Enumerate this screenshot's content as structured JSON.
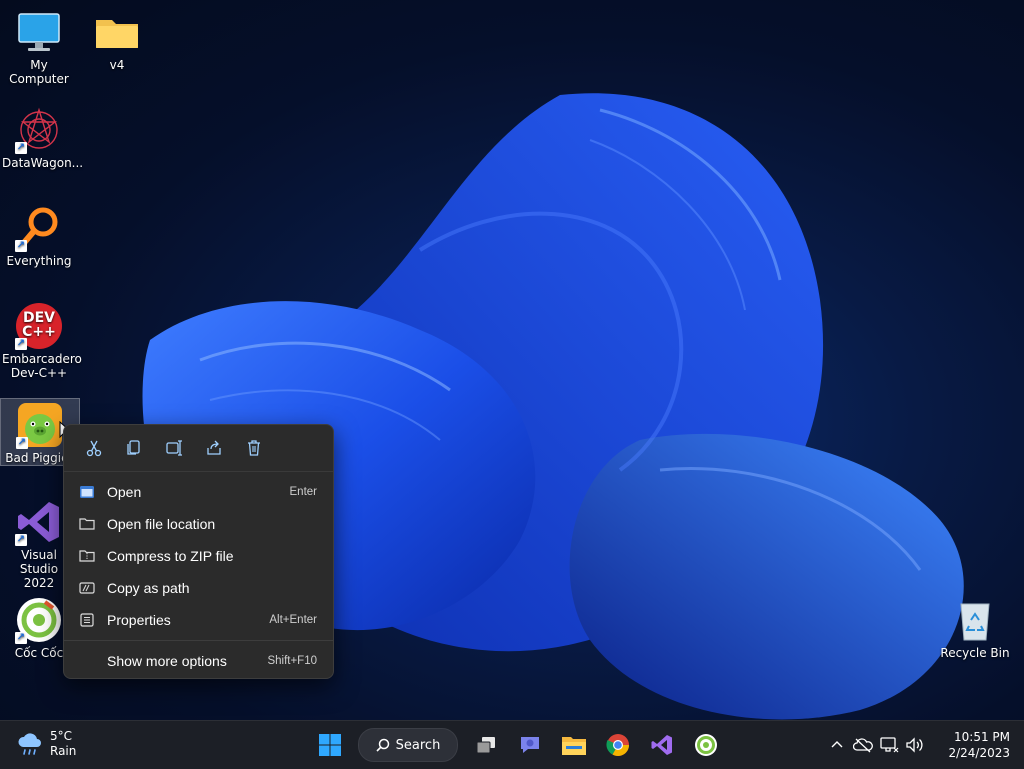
{
  "desktop": {
    "icons": [
      {
        "label": "My Computer",
        "icon": "monitor-icon"
      },
      {
        "label": "v4",
        "icon": "folder-icon"
      },
      {
        "label": "DataWagon...",
        "icon": "datawagon-icon"
      },
      {
        "label": "Everything",
        "icon": "magnifier-icon"
      },
      {
        "label": "Embarcadero\nDev-C++",
        "icon": "devcpp-icon",
        "badge": "DEV C++"
      },
      {
        "label": "Bad Piggies",
        "icon": "bad-piggies-icon"
      },
      {
        "label": "Visual Studio\n2022",
        "icon": "visual-studio-icon"
      },
      {
        "label": "Cốc Cốc",
        "icon": "coccoc-icon"
      },
      {
        "label": "Recycle Bin",
        "icon": "recycle-bin-icon"
      }
    ]
  },
  "context_menu": {
    "toolbar": [
      "cut-icon",
      "copy-icon",
      "rename-icon",
      "share-icon",
      "delete-icon"
    ],
    "items": [
      {
        "label": "Open",
        "shortcut": "Enter",
        "icon": "open-icon"
      },
      {
        "label": "Open file location",
        "shortcut": "",
        "icon": "folder-open-icon"
      },
      {
        "label": "Compress to ZIP file",
        "shortcut": "",
        "icon": "zip-icon"
      },
      {
        "label": "Copy as path",
        "shortcut": "",
        "icon": "path-icon"
      },
      {
        "label": "Properties",
        "shortcut": "Alt+Enter",
        "icon": "properties-icon"
      }
    ],
    "more": {
      "label": "Show more options",
      "shortcut": "Shift+F10"
    }
  },
  "taskbar": {
    "weather": {
      "temp": "5°C",
      "condition": "Rain",
      "icon": "rain-cloud-icon"
    },
    "search_label": "Search",
    "apps": [
      "start-icon",
      "search-icon",
      "task-view-icon",
      "teams-chat-icon",
      "file-explorer-icon",
      "chrome-icon",
      "visual-studio-icon",
      "coccoc-icon"
    ],
    "tray": [
      "chevron-up-icon",
      "onedrive-offline-icon",
      "network-icon",
      "volume-icon"
    ],
    "time": "10:51 PM",
    "date": "2/24/2023"
  },
  "colors": {
    "accent": "#1f5bff",
    "taskbar": "#1c1f26",
    "menu": "#2b2b2b"
  }
}
